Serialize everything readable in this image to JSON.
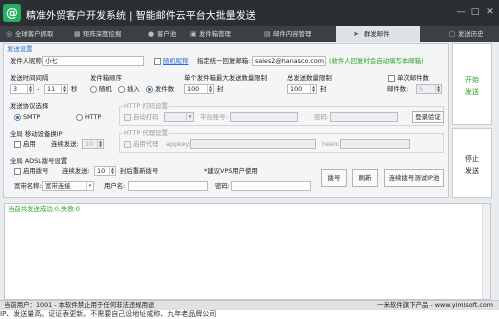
{
  "title": "精准外贸客户开发系统 | 智能邮件云平台大批量发送",
  "window_controls": [
    "—",
    "□",
    "✕"
  ],
  "nav": [
    {
      "label": "全球客户抓取",
      "icon": "globe-icon"
    },
    {
      "label": "矩阵深度挖掘",
      "icon": "matrix-icon"
    },
    {
      "label": "客户池",
      "icon": "users-icon"
    },
    {
      "label": "发件箱管理",
      "icon": "outbox-icon"
    },
    {
      "label": "邮件内容管理",
      "icon": "document-icon"
    },
    {
      "label": "群发邮件",
      "icon": "send-icon",
      "active": true
    },
    {
      "label": "发送历史",
      "icon": "history-icon"
    }
  ],
  "settings": {
    "header": "发送设置",
    "sender_name_label": "发件人昵称:",
    "sender_name_value": "小七",
    "random_nick_label": "随机昵称",
    "reply_label": "指定统一回复邮箱:",
    "reply_value": "sales2@hanasco.com",
    "reply_hint": "(收件人回复时会自动填写本邮箱)",
    "interval_label": "发送时间间隔",
    "interval_from": "3",
    "interval_to": "11",
    "interval_unit": "秒",
    "order_label": "发件箱顺序",
    "order_options": [
      "随机",
      "插入",
      "发件数"
    ],
    "order_selected": 2,
    "single_limit_label": "单个发件箱最大发送数量限制",
    "single_limit_value": "100",
    "single_limit_unit": "封",
    "total_limit_label": "总发送数量限制",
    "total_limit_value": "100",
    "total_limit_unit": "封",
    "single_count_label": "单次邮件数",
    "single_count_sub": "邮件数:",
    "single_count_value": "5"
  },
  "protocol": {
    "label": "发送协议选择",
    "options": [
      "SMTP",
      "HTTP"
    ],
    "selected": 0,
    "http_group_label": "HTTP 打码设置",
    "auto_code_label": "自动打码",
    "platform_label": "平台账号:",
    "password_label": "密码:",
    "login_button": "登录验证"
  },
  "global_ip": {
    "label": "全局 移动设备换IP",
    "enable_label": "启用",
    "count_label": "连续发送:",
    "count_value": "10",
    "proxy_group_label": "HTTP 代理设置",
    "use_proxy_label": "启用代理",
    "appkey_label": "appkey:",
    "neelc_label": "neelc:"
  },
  "adsl": {
    "label": "全局 ADSL拨号设置",
    "enable_label": "启用拨号",
    "count_label": "连续发送:",
    "count_value": "10",
    "after_label": "封后重新拨号",
    "vps_note": "*建议VPS用户使用",
    "broadband_label": "宽带名称:",
    "broadband_value": "宽带连接",
    "username_label": "用户名:",
    "password_label": "密码:",
    "dial_button": "拨号",
    "refresh_button": "刷新",
    "test_button": "连续拨号测试IP池"
  },
  "side_buttons": {
    "start": [
      "开始",
      "发送"
    ],
    "stop": [
      "停止",
      "发送"
    ]
  },
  "log": {
    "text": "当前共发送成功:0,失败:0"
  },
  "status": {
    "left": "当前用户：1001 - 本软件禁止用于任何非法违规用途",
    "right": "一米软件旗下产品 - www.yimisoft.com"
  },
  "bottom_strip": "IP、发送量高。证证表更新。不需要自己设地址或称、九年老品牌公司"
}
